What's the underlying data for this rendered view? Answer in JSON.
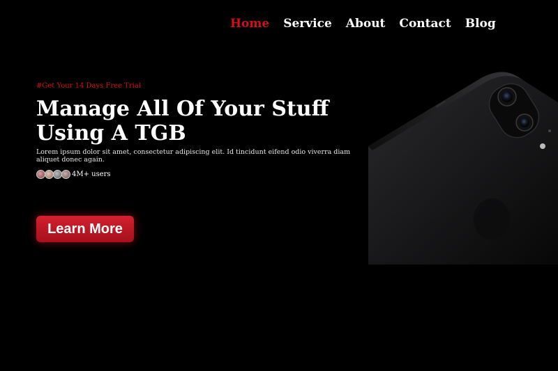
{
  "nav": {
    "items": [
      {
        "label": "Home",
        "active": true
      },
      {
        "label": "Service",
        "active": false
      },
      {
        "label": "About",
        "active": false
      },
      {
        "label": "Contact",
        "active": false
      },
      {
        "label": "Blog",
        "active": false
      }
    ]
  },
  "hero": {
    "eyebrow": "#Get Your 14 Days Free Trial",
    "title_line1": "Manage All Of Your Stuff",
    "title_line2": "Using A TGB",
    "description": "Lorem ipsum dolor sit amet, consectetur adipiscing elit. Id tincidunt eifend odio viverra diam aliquet donec again.",
    "users_text": "4M+ users",
    "cta_label": "Learn More"
  },
  "colors": {
    "background": "#000000",
    "accent": "#d10f16",
    "button": "#c41a28"
  }
}
